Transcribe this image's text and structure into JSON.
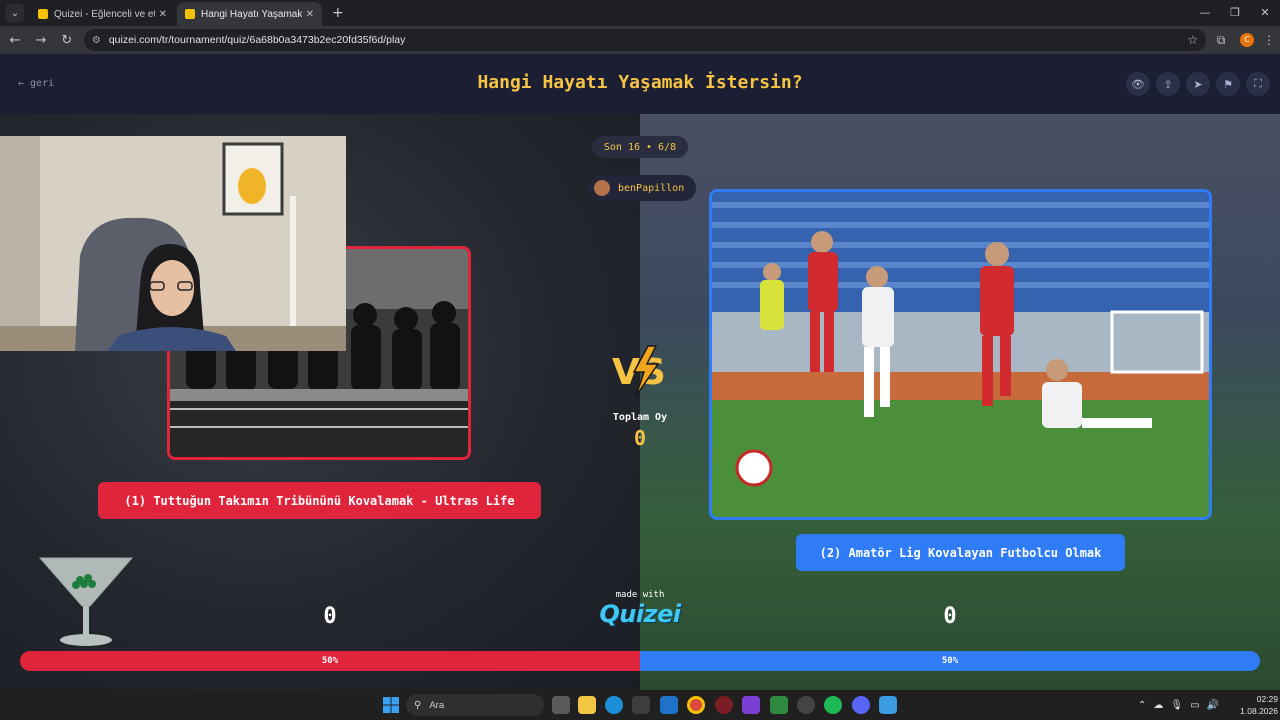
{
  "browser": {
    "tabs": [
      {
        "label": "Quizei - Eğlenceli ve etkileşimli",
        "active": false
      },
      {
        "label": "Hangi Hayatı Yaşamak İstersin?",
        "active": true
      }
    ],
    "new_tab_icon": "plus-icon",
    "url": "quizei.com/tr/tournament/quiz/6a68b0a3473b2ec20fd35f6d/play",
    "profile_initial": "C"
  },
  "header": {
    "title": "Hangi Hayatı Yaşamak İstersin?",
    "back_label": "← geri"
  },
  "round": {
    "label": "Son 16 • 6/8",
    "username": "benPapillon"
  },
  "left": {
    "label": "(1) Tuttuğun Takımın Tribününü Kovalamak - Ultras Life",
    "score": "0",
    "percent_label": "50%",
    "percent": 50,
    "color": "#e0243b"
  },
  "right": {
    "label": "(2) Amatör Lig Kovalayan Futbolcu Olmak",
    "score": "0",
    "percent_label": "50%",
    "percent": 50,
    "color": "#2f7cf6"
  },
  "center": {
    "total_label": "Toplam Oy",
    "total_value": "0",
    "made_with": "made with",
    "brand": "Quizei"
  },
  "taskbar": {
    "search_placeholder": "Ara",
    "time": "02:29",
    "date": "1.08.2026"
  }
}
